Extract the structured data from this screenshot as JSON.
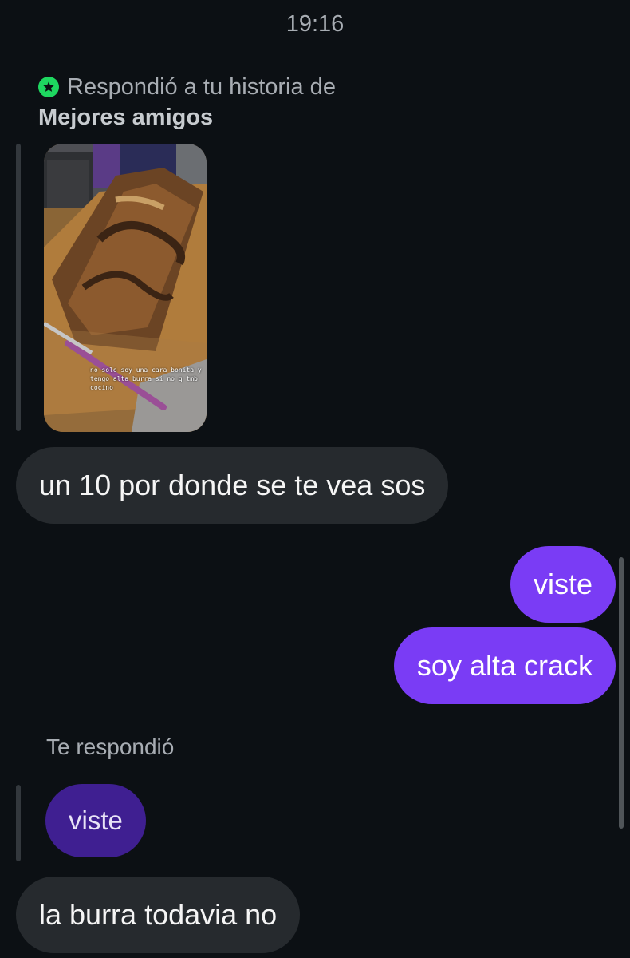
{
  "status": {
    "time": "19:16"
  },
  "story_reply": {
    "prefix": "Respondió a tu historia de",
    "audience": "Mejores amigos",
    "story_caption": "no solo soy una cara bonita y tengo alta burra si no q tmb cocino"
  },
  "messages": [
    {
      "text": "un 10 por donde se te vea sos",
      "side": "received"
    },
    {
      "text": "viste",
      "side": "sent"
    },
    {
      "text": "soy alta crack",
      "side": "sent"
    },
    {
      "text": "la burra todavia no",
      "side": "received"
    }
  ],
  "reply_context": {
    "label": "Te respondió",
    "quoted_text": "viste"
  },
  "colors": {
    "background": "#0c1014",
    "received_bubble": "#262a2e",
    "sent_bubble": "#7a3cf5",
    "quoted_bubble": "#3f1f91",
    "close_friends_badge": "#1ed760"
  }
}
